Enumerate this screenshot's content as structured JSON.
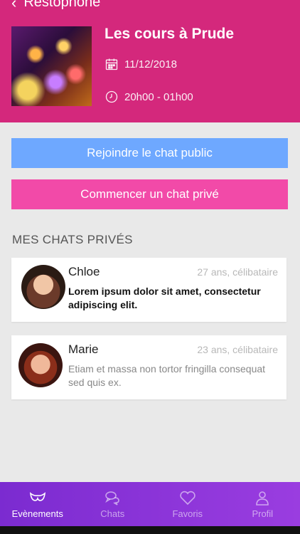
{
  "header": {
    "back_label": "Restophone",
    "event_title": "Les cours à Prude",
    "date": "11/12/2018",
    "time": "20h00 - 01h00"
  },
  "buttons": {
    "public_chat": "Rejoindre le chat public",
    "private_chat": "Commencer un chat privé"
  },
  "section_title": "MES CHATS PRIVÉS",
  "chats": [
    {
      "name": "Chloe",
      "meta": "27 ans, célibataire",
      "message": "Lorem ipsum dolor sit amet, consectetur adipiscing elit.",
      "unread": true
    },
    {
      "name": "Marie",
      "meta": "23 ans, célibataire",
      "message": "Etiam et massa non tortor fringilla consequat sed quis ex.",
      "unread": false
    }
  ],
  "tabs": [
    {
      "label": "Evènements",
      "icon": "mask-icon",
      "active": true
    },
    {
      "label": "Chats",
      "icon": "chat-bubbles-icon",
      "active": false
    },
    {
      "label": "Favoris",
      "icon": "heart-icon",
      "active": false
    },
    {
      "label": "Profil",
      "icon": "user-icon",
      "active": false
    }
  ],
  "colors": {
    "header": "#d4287c",
    "public_button": "#6ea8ff",
    "private_button": "#f24aa8",
    "tabbar": "#8a35d8"
  }
}
